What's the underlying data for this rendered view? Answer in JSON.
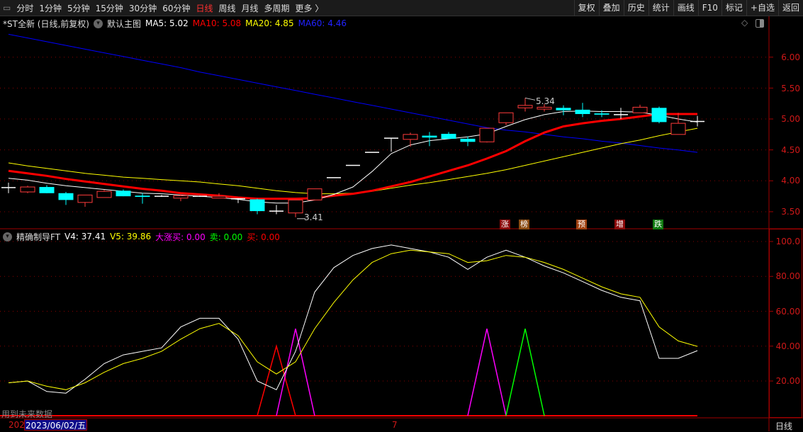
{
  "toolbar": {
    "periods": [
      "分时",
      "1分钟",
      "5分钟",
      "15分钟",
      "30分钟",
      "60分钟",
      "日线",
      "周线",
      "月线",
      "多周期",
      "更多 〉"
    ],
    "active_period": "日线",
    "buttons": [
      "复权",
      "叠加",
      "历史",
      "统计",
      "画线",
      "F10",
      "标记",
      "+自选",
      "返回"
    ]
  },
  "main_legend": {
    "title": "*ST全新 (日线,前复权)",
    "template": "默认主图",
    "ma5": "MA5: 5.02",
    "ma10": "MA10: 5.08",
    "ma20": "MA20: 4.85",
    "ma60": "MA60: 4.46"
  },
  "sub_legend": {
    "title": "精确制导FT",
    "v4": "V4: 37.41",
    "v5": "V5: 39.86",
    "dzm": "大涨买: 0.00",
    "sell": "卖: 0.00",
    "buy": "买: 0.00"
  },
  "price_axis": [
    "6.00",
    "5.50",
    "5.00",
    "4.50",
    "4.00",
    "3.50"
  ],
  "ind_axis": [
    "100.0",
    "80.00",
    "60.00",
    "40.00",
    "20.00"
  ],
  "annotations": {
    "high": "5.34",
    "low": "3.41"
  },
  "tags": [
    {
      "text": "涨",
      "color": "#8a0a0a"
    },
    {
      "text": "榜",
      "color": "#8a4a10"
    },
    {
      "text": "预",
      "color": "#a04010"
    },
    {
      "text": "增",
      "color": "#8a0a0a"
    },
    {
      "text": "跌",
      "color": "#107a10"
    }
  ],
  "footer": {
    "note": "用到未来数据",
    "year_prefix": "202",
    "date": "2023/06/02/五",
    "month_mark": "7",
    "period_label": "日线"
  },
  "colors": {
    "up": "#ff3b3b",
    "down": "#00ffff",
    "ma5": "#ffffff",
    "ma10": "#ff0000",
    "ma20": "#ffff00",
    "ma60": "#0000ff",
    "grid": "#8a0000"
  },
  "chart_data": [
    {
      "type": "candlestick",
      "title": "*ST全新 日线",
      "ylim": [
        3.3,
        6.55
      ],
      "ohlc": [
        [
          3.89,
          3.97,
          3.8,
          3.89
        ],
        [
          3.82,
          3.92,
          3.8,
          3.9
        ],
        [
          3.9,
          3.93,
          3.8,
          3.8
        ],
        [
          3.8,
          3.82,
          3.61,
          3.69
        ],
        [
          3.65,
          3.77,
          3.58,
          3.77
        ],
        [
          3.73,
          3.85,
          3.73,
          3.83
        ],
        [
          3.84,
          3.86,
          3.75,
          3.75
        ],
        [
          3.76,
          3.8,
          3.63,
          3.74
        ],
        [
          3.75,
          3.77,
          3.74,
          3.75
        ],
        [
          3.72,
          3.78,
          3.67,
          3.76
        ],
        [
          3.75,
          3.76,
          3.74,
          3.75
        ],
        [
          3.72,
          3.8,
          3.72,
          3.75
        ],
        [
          3.71,
          3.72,
          3.64,
          3.71
        ],
        [
          3.7,
          3.71,
          3.46,
          3.51
        ],
        [
          3.51,
          3.61,
          3.46,
          3.51
        ],
        [
          3.48,
          3.69,
          3.41,
          3.69
        ],
        [
          3.69,
          3.87,
          3.69,
          3.87
        ],
        [
          4.05,
          4.05,
          4.05,
          4.05
        ],
        [
          4.25,
          4.25,
          4.25,
          4.25
        ],
        [
          4.46,
          4.46,
          4.46,
          4.46
        ],
        [
          4.69,
          4.69,
          4.47,
          4.69
        ],
        [
          4.67,
          4.78,
          4.55,
          4.75
        ],
        [
          4.73,
          4.79,
          4.56,
          4.7
        ],
        [
          4.76,
          4.79,
          4.68,
          4.68
        ],
        [
          4.68,
          4.72,
          4.56,
          4.63
        ],
        [
          4.63,
          4.85,
          4.62,
          4.85
        ],
        [
          4.94,
          5.1,
          4.9,
          5.1
        ],
        [
          5.18,
          5.34,
          5.12,
          5.22
        ],
        [
          5.16,
          5.24,
          5.12,
          5.19
        ],
        [
          5.18,
          5.22,
          5.06,
          5.14
        ],
        [
          5.15,
          5.26,
          5.03,
          5.08
        ],
        [
          5.09,
          5.14,
          5.03,
          5.07
        ],
        [
          5.07,
          5.18,
          5.0,
          5.07
        ],
        [
          5.1,
          5.23,
          5.1,
          5.19
        ],
        [
          5.18,
          5.2,
          4.93,
          4.95
        ],
        [
          4.75,
          5.1,
          4.75,
          4.93
        ],
        [
          4.96,
          5.05,
          4.88,
          4.96
        ]
      ],
      "ma5": [
        4.04,
        4.01,
        3.96,
        3.92,
        3.89,
        3.86,
        3.83,
        3.8,
        3.79,
        3.77,
        3.75,
        3.73,
        3.7,
        3.66,
        3.64,
        3.64,
        3.69,
        3.78,
        3.9,
        4.15,
        4.44,
        4.58,
        4.65,
        4.68,
        4.71,
        4.76,
        4.88,
        4.99,
        5.07,
        5.12,
        5.13,
        5.12,
        5.12,
        5.11,
        5.06,
        5.0,
        4.95
      ],
      "ma10": [
        4.16,
        4.12,
        4.08,
        4.03,
        3.99,
        3.95,
        3.91,
        3.87,
        3.84,
        3.8,
        3.78,
        3.76,
        3.73,
        3.71,
        3.71,
        3.71,
        3.72,
        3.76,
        3.79,
        3.84,
        3.91,
        3.98,
        4.07,
        4.16,
        4.25,
        4.36,
        4.48,
        4.64,
        4.78,
        4.88,
        4.93,
        4.97,
        5.0,
        5.04,
        5.08,
        5.08,
        5.08
      ],
      "ma20": [
        4.29,
        4.24,
        4.2,
        4.16,
        4.12,
        4.09,
        4.06,
        4.04,
        4.02,
        4.0,
        3.98,
        3.95,
        3.92,
        3.88,
        3.84,
        3.81,
        3.79,
        3.79,
        3.8,
        3.83,
        3.88,
        3.93,
        3.97,
        4.02,
        4.07,
        4.12,
        4.18,
        4.25,
        4.32,
        4.39,
        4.46,
        4.53,
        4.6,
        4.66,
        4.73,
        4.79,
        4.85
      ],
      "ma60": [
        6.37,
        6.31,
        6.25,
        6.19,
        6.13,
        6.07,
        6.01,
        5.95,
        5.89,
        5.83,
        5.76,
        5.7,
        5.64,
        5.58,
        5.52,
        5.46,
        5.4,
        5.34,
        5.28,
        5.22,
        5.16,
        5.1,
        5.04,
        4.98,
        4.92,
        4.86,
        4.82,
        4.79,
        4.75,
        4.71,
        4.68,
        4.64,
        4.61,
        4.57,
        4.53,
        4.5,
        4.46
      ],
      "high_index": 27,
      "low_index": 15
    },
    {
      "type": "line",
      "title": "精确制导FT",
      "ylim": [
        0,
        105
      ],
      "series": [
        {
          "name": "V4",
          "color": "#ffffff",
          "values": [
            19,
            20,
            14,
            13,
            21,
            30,
            35,
            37,
            39,
            51,
            56,
            56,
            44,
            20,
            15,
            37,
            71,
            85,
            92,
            96,
            98,
            96,
            94,
            91,
            84,
            91,
            95,
            91,
            86,
            82,
            77,
            72,
            68,
            66,
            33,
            33,
            37.41
          ]
        },
        {
          "name": "V5",
          "color": "#ffff00",
          "values": [
            19,
            20,
            17,
            15,
            19,
            25,
            30,
            33,
            37,
            44,
            50,
            53,
            46,
            31,
            24,
            31,
            50,
            65,
            78,
            88,
            93,
            95,
            94,
            93,
            88,
            89,
            92,
            91,
            88,
            84,
            79,
            74,
            70,
            68,
            51,
            43,
            39.86
          ]
        }
      ],
      "signals": [
        {
          "name": "买",
          "color": "#ff0000",
          "index": 14,
          "value": 40
        },
        {
          "name": "大涨买",
          "color": "#ff00ff",
          "index": 15,
          "value": 50
        },
        {
          "name": "大涨买",
          "color": "#ff00ff",
          "index": 25,
          "value": 50
        },
        {
          "name": "卖",
          "color": "#00ff00",
          "index": 27,
          "value": 50
        }
      ]
    }
  ]
}
